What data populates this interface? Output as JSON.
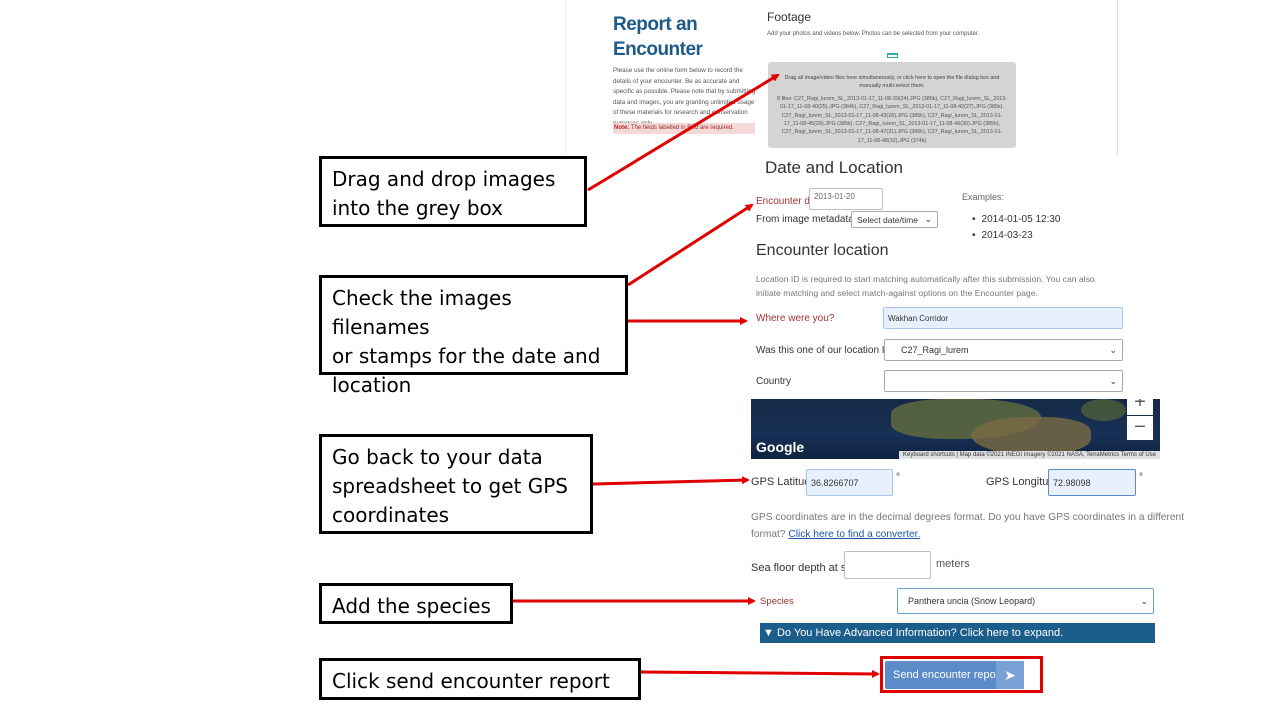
{
  "report": {
    "title": "Report an Encounter",
    "intro": "Please use the online form below to record the details of your encounter. Be as accurate and specific as possible. Please note that by submitting data and images, you are granting unlimited usage of these materials for research and conservation purposes only.",
    "note_label": "Note:",
    "note_text": "The fields labelled in Red are required."
  },
  "footage": {
    "title": "Footage",
    "subtitle": "Add your photos and videos below. Photos can be selected from your computer.",
    "drop_text": "Drag all image/video files here simultaneously, or click here to open the file dialog box and manually multi-select them.",
    "files_text": "8 files: C27_Ragi_lurem_SL_2013-01-17_11-08-39(24).JPG (385k), C27_Ragi_lurem_SL_2013-01-17_11-08-40(25).JPG (384k), C27_Ragi_lurem_SL_2013-01-17_11-08-42(27).JPG (385k), C27_Ragi_lurem_SL_2013-01-17_11-08-43(28).JPG (385k), C27_Ragi_lurem_SL_2013-01-17_11-08-45(29).JPG (385k), C27_Ragi_lurem_SL_2013-01-17_11-08-46(30).JPG (385k), C27_Ragi_lurem_SL_2013-01-17_11-08-47(31).JPG (386k), C27_Ragi_lurem_SL_2013-01-17_11-08-48(32).JPG (374k)"
  },
  "date_location": {
    "title": "Date and Location",
    "encounter_date_label": "Encounter date",
    "encounter_date_value": "2013-01-20",
    "exif_label": "From image metadata (EXIF):",
    "exif_select": "Select date/time",
    "examples_label": "Examples:",
    "examples": [
      "2014-01-05 12:30",
      "2014-03-23"
    ]
  },
  "encounter_location": {
    "title": "Encounter location",
    "help": "Location ID is required to start matching automatically after this submission. You can also initiate matching and select match-against options on the Encounter page.",
    "where_label": "Where were you?",
    "where_value": "Wakhan Corridor",
    "location_id_label": "Was this one of our location IDs?",
    "location_id_value": "C27_Ragi_lurem",
    "country_label": "Country",
    "country_value": ""
  },
  "map": {
    "brand": "Google",
    "attribution": "Keyboard shortcuts | Map data ©2021 INEGI Imagery ©2021 NASA, TerraMetrics   Terms of Use",
    "zoom_in": "+",
    "zoom_out": "−"
  },
  "gps": {
    "lat_label": "GPS Latitude",
    "lat_value": "36.8266707",
    "lon_label": "GPS Longitude",
    "lon_value": "72.98098",
    "degree": "°",
    "help": "GPS coordinates are in the decimal degrees format. Do you have GPS coordinates in a different format?",
    "link": "Click here to find a converter."
  },
  "depth": {
    "label": "Sea floor depth at site",
    "unit": "meters",
    "value": ""
  },
  "species": {
    "label": "Species",
    "value": "Panthera uncia (Snow Leopard)",
    "advanced": "▼ Do You Have Advanced Information? Click here to expand."
  },
  "submit": {
    "label": "Send encounter report",
    "arrow": "➤"
  },
  "callouts": {
    "drag": "Drag and drop images\ninto the grey box",
    "check": "Check the images filenames\nor stamps for the date and\nlocation",
    "gps": "Go back to your data\nspreadsheet to get GPS\ncoordinates",
    "species": "Add the species",
    "send": "Click send encounter report"
  },
  "colors": {
    "arrow": "#e00000",
    "title_blue": "#1d5a8a",
    "required_red": "#a33232",
    "bar_blue": "#1b5e8c",
    "button_blue": "#5b8bc9"
  }
}
